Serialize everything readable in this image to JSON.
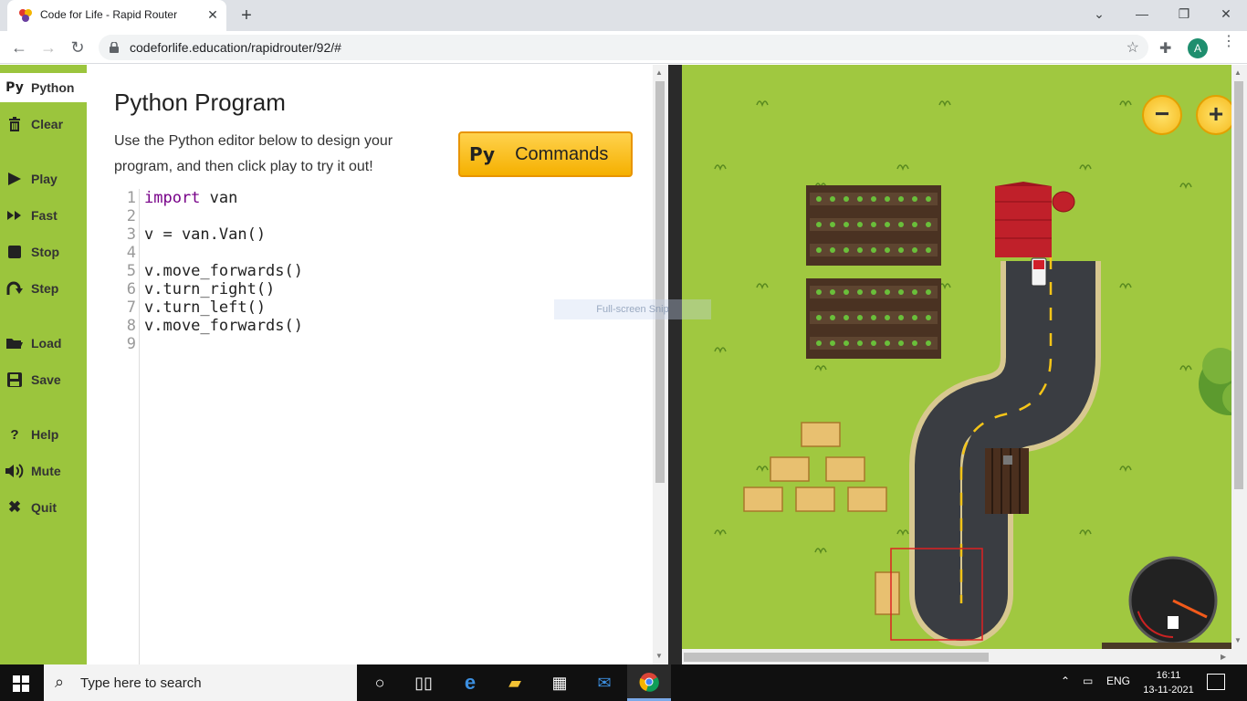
{
  "browser": {
    "tab_title": "Code for Life - Rapid Router",
    "url": "codeforlife.education/rapidrouter/92/#",
    "profile_initial": "A"
  },
  "sidebar": {
    "items": [
      {
        "label": "Python",
        "icon": "Py"
      },
      {
        "label": "Clear",
        "icon": "trash-icon"
      },
      {
        "label": "Play",
        "icon": "play-icon"
      },
      {
        "label": "Fast",
        "icon": "fast-forward-icon"
      },
      {
        "label": "Stop",
        "icon": "stop-icon"
      },
      {
        "label": "Step",
        "icon": "step-icon"
      },
      {
        "label": "Load",
        "icon": "folder-icon"
      },
      {
        "label": "Save",
        "icon": "save-icon"
      },
      {
        "label": "Help",
        "icon": "help-icon"
      },
      {
        "label": "Mute",
        "icon": "speaker-icon"
      },
      {
        "label": "Quit",
        "icon": "quit-icon"
      }
    ]
  },
  "editor": {
    "title": "Python Program",
    "description": "Use the Python editor below to design your program, and then click play to try it out!",
    "commands_button": {
      "prefix": "Py",
      "label": "Commands"
    },
    "line_numbers": [
      "1",
      "2",
      "3",
      "4",
      "5",
      "6",
      "7",
      "8",
      "9"
    ],
    "code_lines": [
      {
        "kw": "import",
        "rest": " van"
      },
      {
        "kw": "",
        "rest": ""
      },
      {
        "kw": "",
        "rest": "v = van.Van()"
      },
      {
        "kw": "",
        "rest": ""
      },
      {
        "kw": "",
        "rest": "v.move_forwards()"
      },
      {
        "kw": "",
        "rest": "v.turn_right()"
      },
      {
        "kw": "",
        "rest": "v.turn_left()"
      },
      {
        "kw": "",
        "rest": "v.move_forwards()"
      },
      {
        "kw": "",
        "rest": ""
      }
    ]
  },
  "overlay": {
    "snip_text": "Full-screen Snip"
  },
  "game": {
    "zoom_out": "−",
    "zoom_in": "+"
  },
  "taskbar": {
    "search_placeholder": "Type here to search",
    "language": "ENG",
    "time": "16:11",
    "date": "13-11-2021"
  }
}
